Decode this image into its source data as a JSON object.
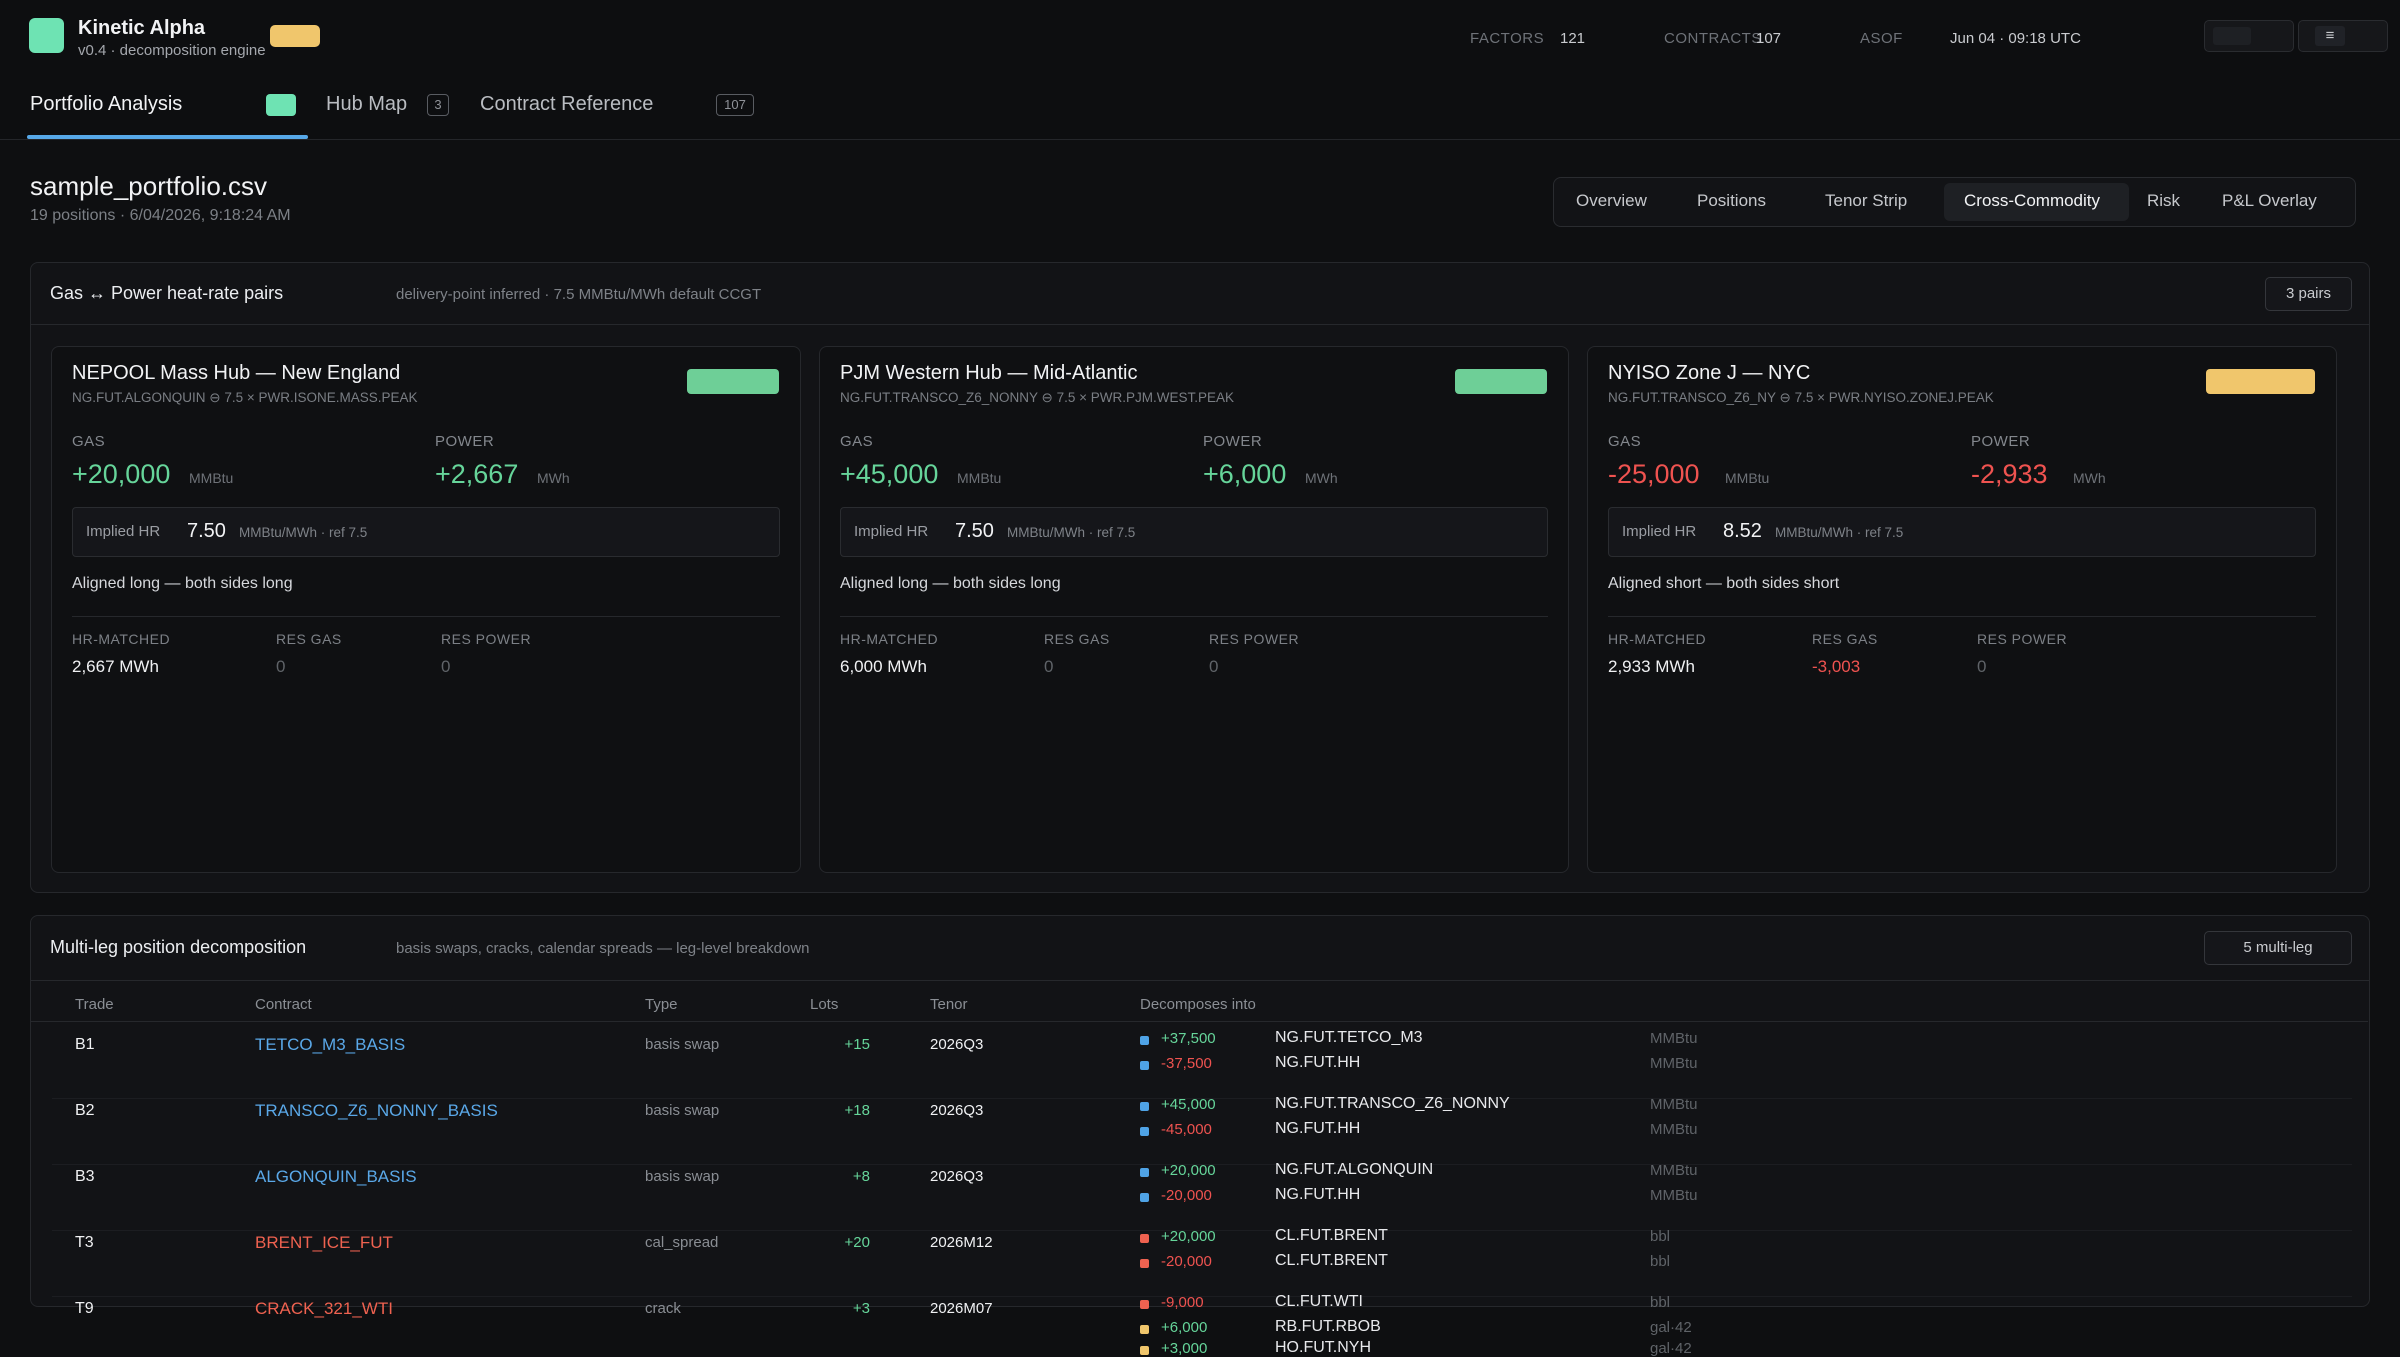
{
  "header": {
    "app_name": "Kinetic Alpha",
    "app_subtitle": "v0.4 · decomposition engine",
    "stats": [
      {
        "label": "FACTORS",
        "value": "121"
      },
      {
        "label": "CONTRACTS",
        "value": "107"
      },
      {
        "label": "ASOF",
        "value": "Jun 04 · 09:18 UTC"
      }
    ],
    "menu_glyph": "≡"
  },
  "nav": {
    "tabs": [
      {
        "label": "Portfolio Analysis"
      },
      {
        "label": "Hub Map",
        "count": "3"
      },
      {
        "label": "Contract Reference",
        "count": "107"
      }
    ]
  },
  "file": {
    "name": "sample_portfolio.csv",
    "meta": "19 positions · 6/04/2026, 9:18:24 AM"
  },
  "view_tabs": [
    "Overview",
    "Positions",
    "Tenor Strip",
    "Cross-Commodity",
    "Risk",
    "P&L Overlay"
  ],
  "heat_rate": {
    "title": "Gas ↔ Power heat-rate pairs",
    "hint": "delivery-point inferred · 7.5 MMBtu/MWh default CCGT",
    "pill": "3 pairs",
    "labels": {
      "gas": "GAS",
      "power": "POWER",
      "implied_hr": "Implied HR",
      "hr_matched": "HR-MATCHED",
      "res_gas": "RES GAS",
      "res_power": "RES POWER"
    },
    "cards": [
      {
        "title": "NEPOOL Mass Hub — New England",
        "ident": "NG.FUT.ALGONQUIN ⊖ 7.5 × PWR.ISONE.MASS.PEAK",
        "badge_color": "#6ecf97",
        "gas": "+20,000",
        "gas_unit": "MMBtu",
        "power": "+2,667",
        "power_unit": "MWh",
        "hr": "7.50",
        "hr_unit": "MMBtu/MWh · ref 7.5",
        "alignment": "Aligned long — both sides long",
        "hr_matched": "2,667 MWh",
        "res_gas": "0",
        "res_power": "0"
      },
      {
        "title": "PJM Western Hub — Mid-Atlantic",
        "ident": "NG.FUT.TRANSCO_Z6_NONNY ⊖ 7.5 × PWR.PJM.WEST.PEAK",
        "badge_color": "#6ecf97",
        "gas": "+45,000",
        "gas_unit": "MMBtu",
        "power": "+6,000",
        "power_unit": "MWh",
        "hr": "7.50",
        "hr_unit": "MMBtu/MWh · ref 7.5",
        "alignment": "Aligned long — both sides long",
        "hr_matched": "6,000 MWh",
        "res_gas": "0",
        "res_power": "0"
      },
      {
        "title": "NYISO Zone J — NYC",
        "ident": "NG.FUT.TRANSCO_Z6_NY ⊖ 7.5 × PWR.NYISO.ZONEJ.PEAK",
        "badge_color": "#f0c66c",
        "gas": "-25,000",
        "gas_unit": "MMBtu",
        "power": "-2,933",
        "power_unit": "MWh",
        "hr": "8.52",
        "hr_unit": "MMBtu/MWh · ref 7.5",
        "alignment": "Aligned short — both sides short",
        "hr_matched": "2,933 MWh",
        "res_gas": "-3,003",
        "res_power": "0"
      }
    ]
  },
  "multileg": {
    "title": "Multi-leg position decomposition",
    "hint": "basis swaps, cracks, calendar spreads — leg-level breakdown",
    "pill": "5 multi-leg",
    "columns": [
      "Trade",
      "Contract",
      "Type",
      "Lots",
      "Tenor",
      "Decomposes into"
    ],
    "rows": [
      {
        "trade": "B1",
        "contract": "TETCO_M3_BASIS",
        "type": "basis swap",
        "lots": "+15",
        "tenor": "2026Q3",
        "legs": [
          {
            "qty": "+37,500",
            "name": "NG.FUT.TETCO_M3",
            "unit": "MMBtu"
          },
          {
            "qty": "-37,500",
            "name": "NG.FUT.HH",
            "unit": "MMBtu"
          }
        ]
      },
      {
        "trade": "B2",
        "contract": "TRANSCO_Z6_NONNY_BASIS",
        "type": "basis swap",
        "lots": "+18",
        "tenor": "2026Q3",
        "legs": [
          {
            "qty": "+45,000",
            "name": "NG.FUT.TRANSCO_Z6_NONNY",
            "unit": "MMBtu"
          },
          {
            "qty": "-45,000",
            "name": "NG.FUT.HH",
            "unit": "MMBtu"
          }
        ]
      },
      {
        "trade": "B3",
        "contract": "ALGONQUIN_BASIS",
        "type": "basis swap",
        "lots": "+8",
        "tenor": "2026Q3",
        "legs": [
          {
            "qty": "+20,000",
            "name": "NG.FUT.ALGONQUIN",
            "unit": "MMBtu"
          },
          {
            "qty": "-20,000",
            "name": "NG.FUT.HH",
            "unit": "MMBtu"
          }
        ]
      },
      {
        "trade": "T3",
        "contract": "BRENT_ICE_FUT",
        "type": "cal_spread",
        "lots": "+20",
        "tenor": "2026M12",
        "legs": [
          {
            "qty": "+20,000",
            "name": "CL.FUT.BRENT",
            "unit": "bbl"
          },
          {
            "qty": "-20,000",
            "name": "CL.FUT.BRENT",
            "unit": "bbl"
          }
        ]
      },
      {
        "trade": "T9",
        "contract": "CRACK_321_WTI",
        "type": "crack",
        "lots": "+3",
        "tenor": "2026M07",
        "legs": [
          {
            "qty": "-9,000",
            "name": "CL.FUT.WTI",
            "unit": "bbl"
          },
          {
            "qty": "+6,000",
            "name": "RB.FUT.RBOB",
            "unit": "gal·42"
          },
          {
            "qty": "+3,000",
            "name": "HO.FUT.NYH",
            "unit": "gal·42"
          }
        ]
      }
    ]
  },
  "colors": {
    "accent_green": "#6ee3b3",
    "accent_blue": "#57a8e8",
    "positive": "#66d59a",
    "negative": "#ef5350",
    "warning": "#f0c66c",
    "leg_blue": "#4fa3e6",
    "leg_red": "#ef6250",
    "leg_yellow": "#f0c66c"
  }
}
